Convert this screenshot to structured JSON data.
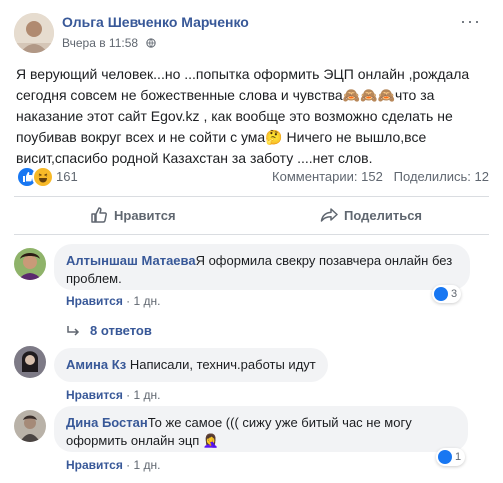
{
  "post": {
    "author": "Ольга Шевченко Марченко",
    "time": "Вчера в 11:58",
    "text_lines": [
      "Я верующий человек...но ...попытка оформить ЭЦП онлайн ,рождала",
      "сегодня совсем не божественные слова и чувства🙈🙈🙈что за",
      "наказание этот сайт Egov.kz , как вообще это возможно сделать не",
      "поубивав вокруг всех и не сойти с ума🤔 Ничего не вышло,все",
      "висит,спасибо родной Казахстан за заботу ....нет слов."
    ],
    "reaction_count": "161",
    "comments_label": "Комментарии: 152",
    "shares_label": "Поделились: 12",
    "like_label": "Нравится",
    "share_label": "Поделиться",
    "more_icon": "ellipsis-icon"
  },
  "comments": [
    {
      "name": "Алтыншаш Матаева",
      "text": "Я оформила свекру позавчера онлайн без проблем.",
      "like": "Нравится",
      "age": "1 дн.",
      "reactions": "3"
    },
    {
      "name": "Амина Кз",
      "text": "Написали, технич.работы идут",
      "like": "Нравится",
      "age": "1 дн."
    },
    {
      "name": "Дина Бостан",
      "text": "То же самое ((( сижу уже битый час не могу оформить онлайн эцп 🤦‍♀️",
      "like": "Нравится",
      "age": "1 дн.",
      "reactions": "1"
    }
  ],
  "replies_label": "8 ответов",
  "colors": {
    "link": "#385898",
    "like_blue": "#1877f2",
    "haha_yellow": "#f7b928",
    "bubble": "#f2f3f5"
  }
}
